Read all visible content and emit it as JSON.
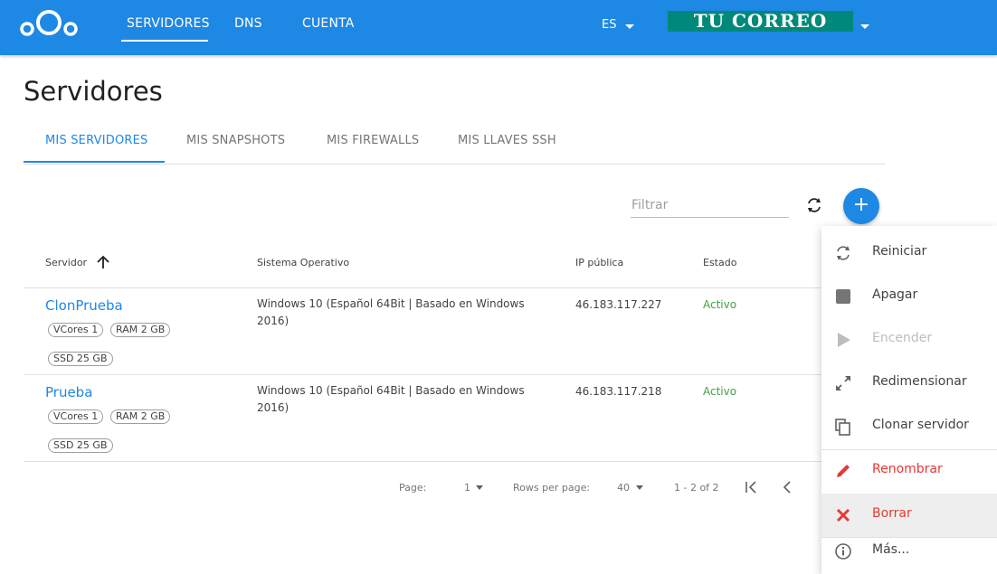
{
  "header": {
    "logo_icon": "nextcloud-logo-icon",
    "nav": [
      "SERVIDORES",
      "DNS",
      "CUENTA"
    ],
    "active_nav": "SERVIDORES",
    "language": "ES",
    "account_label": "TU CORREO",
    "colors": {
      "bar": "#1e88e5",
      "account_badge": "#00897b"
    }
  },
  "page": {
    "title": "Servidores",
    "tabs": [
      "MIS SERVIDORES",
      "MIS SNAPSHOTS",
      "MIS FIREWALLS",
      "MIS LLAVES SSH"
    ],
    "active_tab": "MIS SERVIDORES"
  },
  "toolbar": {
    "filter_placeholder": "Filtrar",
    "refresh_icon": "refresh-icon",
    "add_label": "+"
  },
  "table": {
    "columns": [
      "Servidor",
      "Sistema Operativo",
      "IP pública",
      "Estado"
    ],
    "sort_icon": "arrow-up-icon",
    "rows": [
      {
        "name": "ClonPrueba",
        "chips": [
          "VCores 1",
          "RAM 2 GB",
          "SSD 25 GB"
        ],
        "os": "Windows 10 (Español 64Bit | Basado en Windows 2016)",
        "ip": "46.183.117.227",
        "status": "Activo"
      },
      {
        "name": "Prueba",
        "chips": [
          "VCores 1",
          "RAM 2 GB",
          "SSD 25 GB"
        ],
        "os": "Windows 10 (Español 64Bit | Basado en Windows 2016)",
        "ip": "46.183.117.218",
        "status": "Activo"
      }
    ]
  },
  "pagination": {
    "page_label": "Page:",
    "page_value": "1",
    "rows_label": "Rows per page:",
    "rows_value": "40",
    "range": "1 - 2 of 2"
  },
  "context_menu": {
    "items": [
      {
        "label": "Reiniciar",
        "icon": "refresh-icon",
        "state": "normal"
      },
      {
        "label": "Apagar",
        "icon": "stop-icon",
        "state": "normal"
      },
      {
        "label": "Encender",
        "icon": "play-icon",
        "state": "disabled"
      },
      {
        "label": "Redimensionar",
        "icon": "resize-icon",
        "state": "normal"
      },
      {
        "label": "Clonar servidor",
        "icon": "copy-icon",
        "state": "normal"
      },
      {
        "label": "Renombrar",
        "icon": "pencil-icon",
        "state": "danger"
      },
      {
        "label": "Borrar",
        "icon": "close-icon",
        "state": "danger-hover"
      },
      {
        "label": "Más...",
        "icon": "info-icon",
        "state": "normal"
      }
    ]
  }
}
